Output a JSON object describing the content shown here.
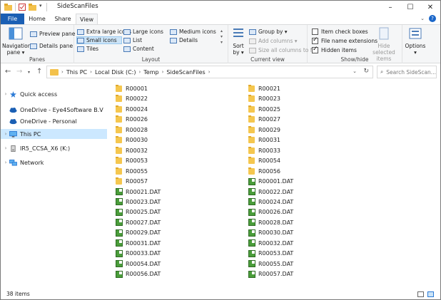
{
  "window": {
    "title": "SideScanFiles",
    "controls": {
      "minimize": "–",
      "maximize": "☐",
      "close": "✕"
    }
  },
  "tabs": [
    {
      "label": "File"
    },
    {
      "label": "Home"
    },
    {
      "label": "Share"
    },
    {
      "label": "View"
    }
  ],
  "ribbon": {
    "panes": {
      "label": "Panes",
      "navigation_pane": "Navigation pane",
      "nav_line1": "Navigation",
      "nav_line2": "pane ▾",
      "preview_pane": "Preview pane",
      "details_pane": "Details pane"
    },
    "layout": {
      "label": "Layout",
      "items": [
        "Extra large icons",
        "Large icons",
        "Medium icons",
        "Small icons",
        "List",
        "Details",
        "Tiles",
        "Content"
      ],
      "selected": "Small icons"
    },
    "current_view": {
      "label": "Current view",
      "sort_line1": "Sort",
      "sort_line2": "by ▾",
      "group_by": "Group by ▾",
      "add_columns": "Add columns ▾",
      "size_columns": "Size all columns to fit"
    },
    "show_hide": {
      "label": "Show/hide",
      "item_check_boxes": {
        "label": "Item check boxes",
        "checked": false
      },
      "file_name_extensions": {
        "label": "File name extensions",
        "checked": true
      },
      "hidden_items": {
        "label": "Hidden items",
        "checked": true
      },
      "hide_selected_line1": "Hide selected",
      "hide_selected_line2": "items"
    },
    "options": {
      "label": "Options",
      "arrow": "▾"
    }
  },
  "address": {
    "crumbs": [
      "This PC",
      "Local Disk (C:)",
      "Temp",
      "SideScanFiles"
    ],
    "search_placeholder": "Search SideScan..."
  },
  "nav": [
    {
      "label": "Quick access",
      "icon": "star-icon"
    },
    {
      "label": "OneDrive - Eye4Software B.V",
      "icon": "cloud-icon"
    },
    {
      "label": "OneDrive - Personal",
      "icon": "cloud-icon"
    },
    {
      "label": "This PC",
      "icon": "monitor-icon",
      "selected": true
    },
    {
      "label": "IR5_CCSA_X6 (K:)",
      "icon": "drive-icon"
    },
    {
      "label": "Network",
      "icon": "network-icon"
    }
  ],
  "files": {
    "col1": [
      "R00001",
      "R00022",
      "R00024",
      "R00026",
      "R00028",
      "R00030",
      "R00032",
      "R00053",
      "R00055",
      "R00057",
      "R00021.DAT",
      "R00023.DAT",
      "R00025.DAT",
      "R00027.DAT",
      "R00029.DAT",
      "R00031.DAT",
      "R00033.DAT",
      "R00054.DAT",
      "R00056.DAT"
    ],
    "col1_types": [
      "folder",
      "folder",
      "folder",
      "folder",
      "folder",
      "folder",
      "folder",
      "folder",
      "folder",
      "folder",
      "dat",
      "dat",
      "dat",
      "dat",
      "dat",
      "dat",
      "dat",
      "dat",
      "dat"
    ],
    "col2": [
      "R00021",
      "R00023",
      "R00025",
      "R00027",
      "R00029",
      "R00031",
      "R00033",
      "R00054",
      "R00056",
      "R00001.DAT",
      "R00022.DAT",
      "R00024.DAT",
      "R00026.DAT",
      "R00028.DAT",
      "R00030.DAT",
      "R00032.DAT",
      "R00053.DAT",
      "R00055.DAT",
      "R00057.DAT"
    ],
    "col2_types": [
      "folder",
      "folder",
      "folder",
      "folder",
      "folder",
      "folder",
      "folder",
      "folder",
      "folder",
      "dat",
      "dat",
      "dat",
      "dat",
      "dat",
      "dat",
      "dat",
      "dat",
      "dat",
      "dat"
    ]
  },
  "status": {
    "count": "38 items"
  },
  "colors": {
    "file_tab": "#1a5fb4",
    "selection": "#cce8ff",
    "folder": "#f5c74f",
    "dat_icon": "#4a9d3a"
  }
}
